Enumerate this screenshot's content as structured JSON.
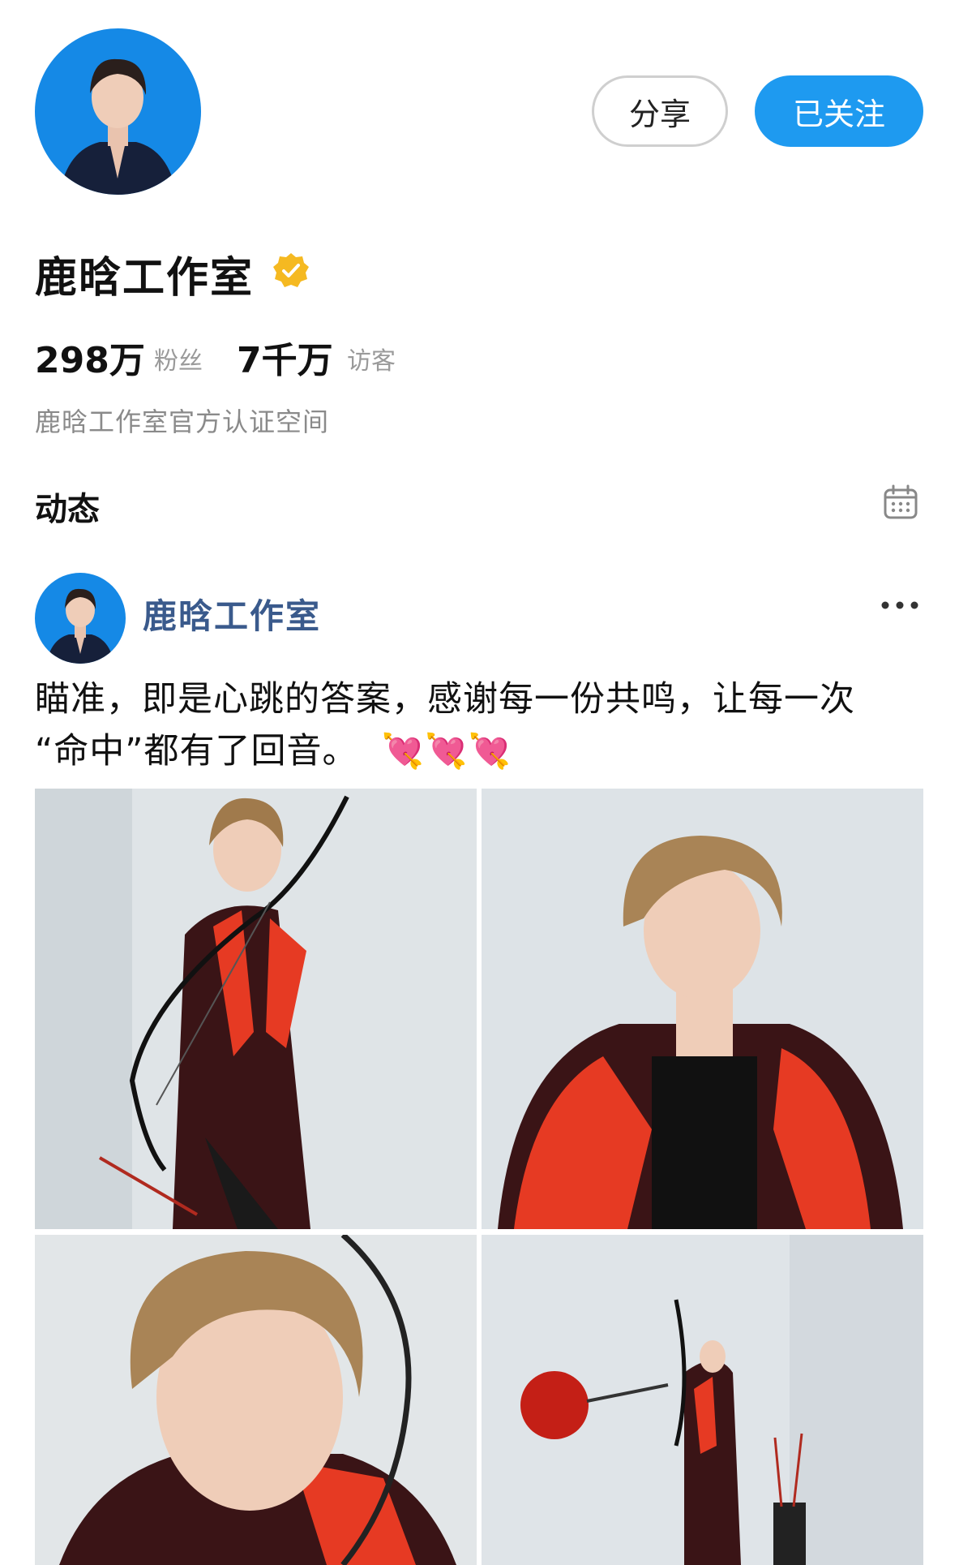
{
  "profile": {
    "name": "鹿晗工作室",
    "share_label": "分享",
    "follow_label": "已关注",
    "fans_count": "298万",
    "fans_label": "粉丝",
    "visitors_count": "7千万",
    "visitors_label": "访客",
    "description": "鹿晗工作室官方认证空间"
  },
  "feed": {
    "section_title": "动态"
  },
  "post": {
    "author": "鹿晗工作室",
    "text_line1": "瞄准，即是心跳的答案，感谢每一份共鸣，让每一次",
    "text_line2": "“命中”都有了回音。",
    "emojis": "💘💘💘"
  },
  "colors": {
    "accent": "#1e9af0",
    "author_link": "#3a5a8c",
    "verify_badge": "#f5b921",
    "muted_text": "#9a9a9a"
  },
  "icons": {
    "verify": "verified-badge-icon",
    "calendar": "calendar-icon",
    "more": "more-dots-icon"
  }
}
